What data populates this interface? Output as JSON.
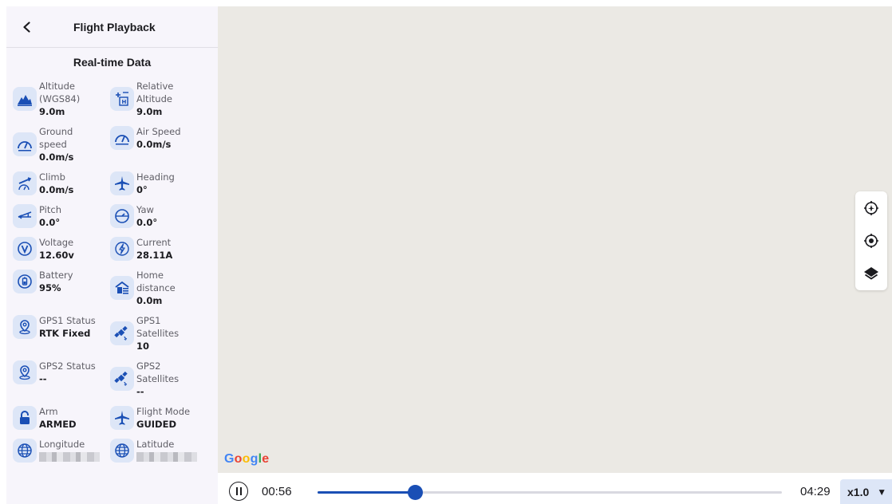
{
  "header": {
    "title": "Flight Playback"
  },
  "section_title": "Real-time Data",
  "telemetry": [
    {
      "left": {
        "icon": "altitude-mountain-icon",
        "label": "Altitude (WGS84)",
        "label_lines": [
          "Altitude",
          "(WGS84)"
        ],
        "value": "9.0m"
      },
      "right": {
        "icon": "relative-altitude-icon",
        "label_lines": [
          "Relative",
          "Altitude"
        ],
        "value": "9.0m"
      }
    },
    {
      "left": {
        "icon": "speedometer-icon",
        "label_lines": [
          "Ground",
          "speed"
        ],
        "value": "0.0m/s"
      },
      "right": {
        "icon": "speedometer-icon",
        "label_lines": [
          "Air Speed"
        ],
        "value": "0.0m/s"
      }
    },
    {
      "left": {
        "icon": "climb-icon",
        "label_lines": [
          "Climb"
        ],
        "value": "0.0m/s"
      },
      "right": {
        "icon": "airplane-icon",
        "label_lines": [
          "Heading"
        ],
        "value": "0°"
      }
    },
    {
      "left": {
        "icon": "pitch-icon",
        "label_lines": [
          "Pitch"
        ],
        "value": "0.0°"
      },
      "right": {
        "icon": "yaw-icon",
        "label_lines": [
          "Yaw"
        ],
        "value": "0.0°"
      }
    },
    {
      "left": {
        "icon": "voltage-icon",
        "label_lines": [
          "Voltage"
        ],
        "value": "12.60v"
      },
      "right": {
        "icon": "current-icon",
        "label_lines": [
          "Current"
        ],
        "value": "28.11A"
      }
    },
    {
      "left": {
        "icon": "battery-icon",
        "label_lines": [
          "Battery"
        ],
        "value": "95%"
      },
      "right": {
        "icon": "home-distance-icon",
        "label_lines": [
          "Home",
          "distance"
        ],
        "value": "0.0m"
      }
    },
    {
      "left": {
        "icon": "gps-pin-icon",
        "label_lines": [
          "GPS1 Status"
        ],
        "value": "RTK Fixed"
      },
      "right": {
        "icon": "satellite-icon",
        "label_lines": [
          "GPS1",
          "Satellites"
        ],
        "value": "10"
      }
    },
    {
      "left": {
        "icon": "gps-pin-icon",
        "label_lines": [
          "GPS2 Status"
        ],
        "value": "--"
      },
      "right": {
        "icon": "satellite-icon",
        "label_lines": [
          "GPS2",
          "Satellites"
        ],
        "value": "--"
      }
    },
    {
      "left": {
        "icon": "lock-icon",
        "label_lines": [
          "Arm"
        ],
        "value": "ARMED"
      },
      "right": {
        "icon": "airplane-icon",
        "label_lines": [
          "Flight Mode"
        ],
        "value": "GUIDED"
      }
    },
    {
      "left": {
        "icon": "globe-icon",
        "label_lines": [
          "Longitude"
        ],
        "value": ""
      },
      "right": {
        "icon": "globe-icon",
        "label_lines": [
          "Latitude"
        ],
        "value": ""
      }
    }
  ],
  "map": {
    "attribution": "Google",
    "controls": [
      "locate-aircraft-icon",
      "my-location-icon",
      "layers-icon"
    ]
  },
  "playback": {
    "current_time": "00:56",
    "total_time": "04:29",
    "progress": 0.21,
    "speed_label": "x1.0",
    "state": "playing"
  },
  "colors": {
    "accent": "#1a4fb5",
    "icon_bg": "#dde6f7",
    "sidebar_bg": "#f7f5fb",
    "map_bg": "#ebe9e4"
  }
}
